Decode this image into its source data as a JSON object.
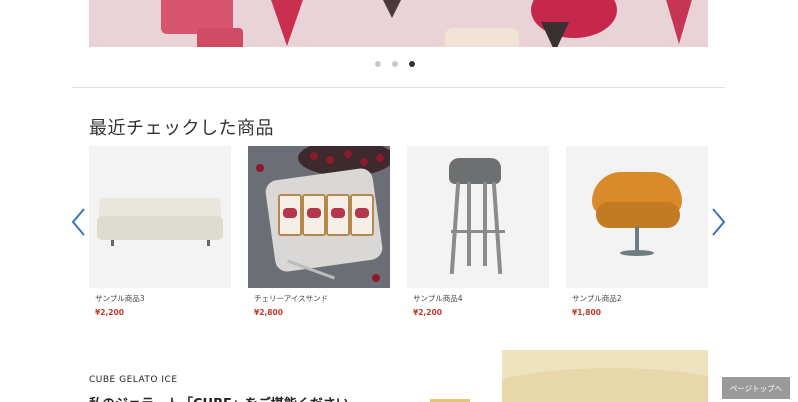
{
  "carousel": {
    "dots": [
      {
        "active": false
      },
      {
        "active": false
      },
      {
        "active": true
      }
    ]
  },
  "recent": {
    "title": "最近チェックした商品",
    "items": [
      {
        "name": "サンプル商品3",
        "price": "¥2,200",
        "icon": "sofa-image"
      },
      {
        "name": "チェリーアイスサンド",
        "price": "¥2,800",
        "icon": "ice-sandwich-image"
      },
      {
        "name": "サンプル商品4",
        "price": "¥2,200",
        "icon": "bar-stool-image"
      },
      {
        "name": "サンプル商品2",
        "price": "¥1,800",
        "icon": "lounge-chair-image"
      }
    ]
  },
  "feature": {
    "label": "CUBE GELATO ICE",
    "heading": "私のジェラート「CUBE」をご堪能ください"
  },
  "page_top": {
    "label": "ページトップへ"
  },
  "colors": {
    "price": "#c0392b",
    "arrow": "#3c73b7",
    "page_top_bg": "#9a9a9a"
  }
}
